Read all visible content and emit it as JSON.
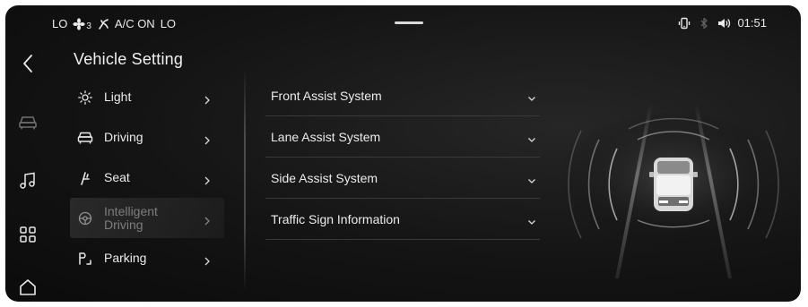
{
  "status": {
    "left_temp": "LO",
    "fan_level": "3",
    "ac_label": "A/C ON",
    "right_temp": "LO",
    "time": "01:51"
  },
  "rail": {
    "icons": [
      "back-arrow-icon",
      "car-icon",
      "music-icon",
      "apps-grid-icon",
      "home-icon"
    ]
  },
  "settings": {
    "title": "Vehicle Setting",
    "items": [
      {
        "label": "Light",
        "icon": "light-icon"
      },
      {
        "label": "Driving",
        "icon": "car-icon"
      },
      {
        "label": "Seat",
        "icon": "seat-icon"
      },
      {
        "label": "Intelligent\nDriving",
        "icon": "steering-wheel-icon",
        "active": true
      },
      {
        "label": "Parking",
        "icon": "parking-icon"
      }
    ]
  },
  "assist": {
    "items": [
      {
        "label": "Front Assist System"
      },
      {
        "label": "Lane Assist System"
      },
      {
        "label": "Side Assist System"
      },
      {
        "label": "Traffic Sign Information"
      }
    ]
  },
  "colors": {
    "background": "#141414",
    "text": "#ececec",
    "muted": "#7d7d7d",
    "divider": "#3a3a3a"
  }
}
